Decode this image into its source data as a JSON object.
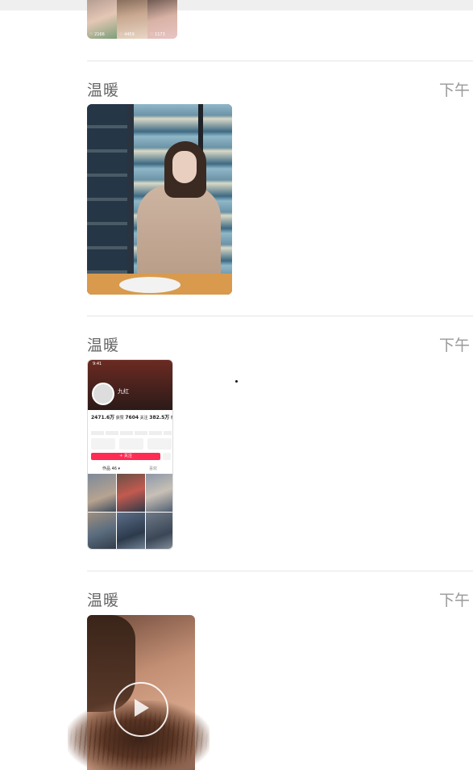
{
  "posts": [
    {
      "thumbnails": [
        {
          "stat": "♡ 2166"
        },
        {
          "stat": "♡ 4459"
        },
        {
          "stat": "♡ 1173"
        }
      ]
    },
    {
      "sender": "温暖",
      "time": "下午",
      "media": "photo"
    },
    {
      "sender": "温暖",
      "time": "下午",
      "media": "app-screenshot",
      "screenshot": {
        "status_time": "9:41",
        "profile_name": "九红",
        "stats": [
          {
            "value": "2471.6万",
            "label": "获赞"
          },
          {
            "value": "7604",
            "label": "关注"
          },
          {
            "value": "382.5万",
            "label": "粉丝"
          }
        ],
        "follow_label": "+ 关注",
        "tabs": [
          "作品 46 ▾",
          "喜欢"
        ]
      }
    },
    {
      "sender": "温暖",
      "time": "下午",
      "media": "video"
    }
  ]
}
